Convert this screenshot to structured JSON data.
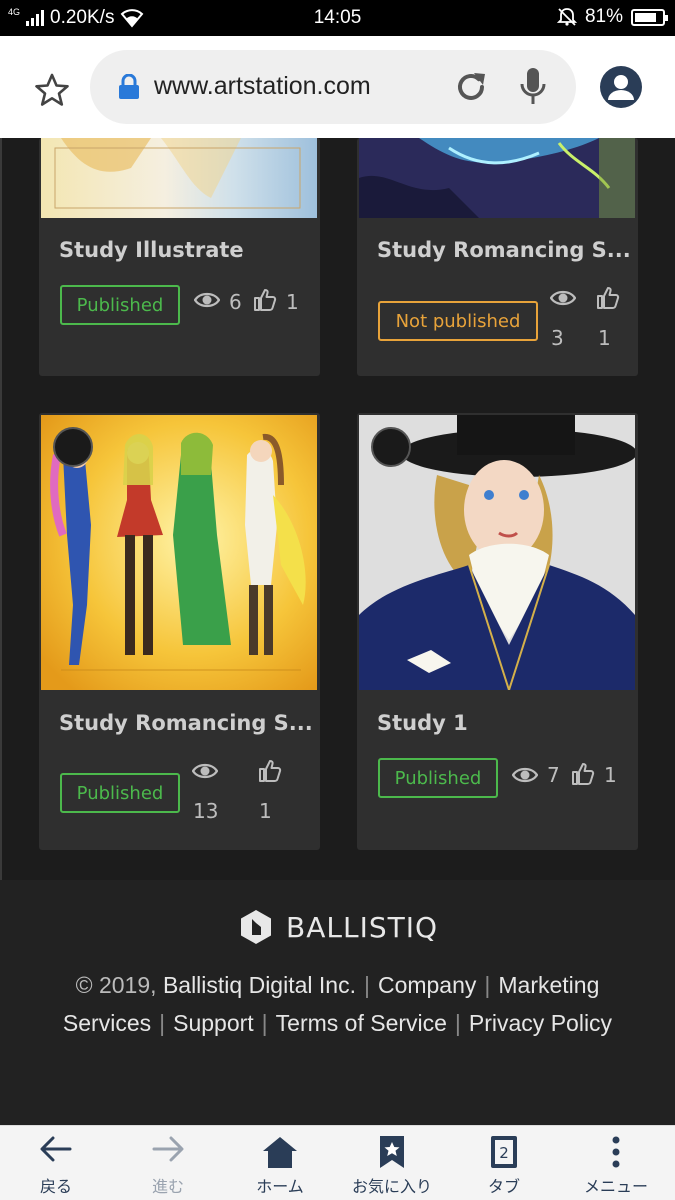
{
  "status_bar": {
    "network_type": "4G",
    "speed": "0.20K/s",
    "time": "14:05",
    "battery": "81%",
    "battery_level": 0.81
  },
  "browser": {
    "url": "www.artstation.com"
  },
  "cards": [
    {
      "title": "Study Illustrate",
      "status": "Published",
      "views": "6",
      "likes": "1"
    },
    {
      "title": "Study Romancing S...",
      "status": "Not published",
      "views": "3",
      "likes": "1"
    },
    {
      "title": "Study Romancing S...",
      "status": "Published",
      "views": "13",
      "likes": "1"
    },
    {
      "title": "Study 1",
      "status": "Published",
      "views": "7",
      "likes": "1"
    }
  ],
  "footer": {
    "brand": "BALLISTIQ",
    "copyright": "© 2019,",
    "company_name": "Ballistiq Digital Inc.",
    "links": [
      "Company",
      "Marketing Services",
      "Support",
      "Terms of Service",
      "Privacy Policy"
    ]
  },
  "bottom_nav": [
    {
      "label": "戻る",
      "icon": "back-arrow-icon"
    },
    {
      "label": "進む",
      "icon": "forward-arrow-icon"
    },
    {
      "label": "ホーム",
      "icon": "home-icon"
    },
    {
      "label": "お気に入り",
      "icon": "bookmark-star-icon"
    },
    {
      "label": "タブ",
      "icon": "tabs-icon",
      "count": "2"
    },
    {
      "label": "メニュー",
      "icon": "menu-dots-icon"
    }
  ],
  "colors": {
    "published": "#4cb94c",
    "not_published": "#e8a33a",
    "nav_accent": "#2a3d57",
    "lock": "#2979d9"
  }
}
